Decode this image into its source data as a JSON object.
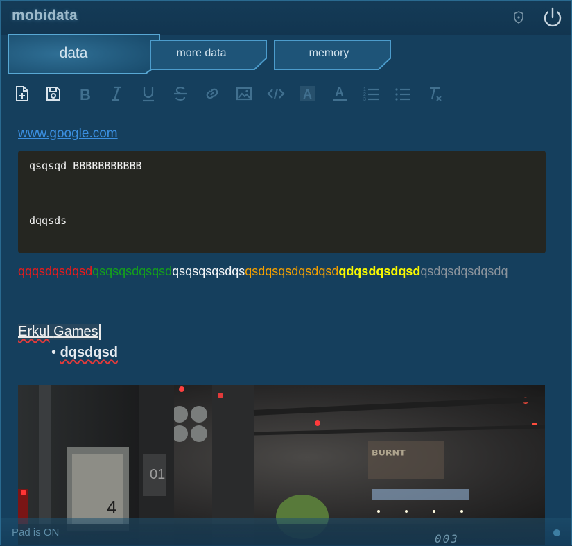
{
  "app": {
    "title": "mobidata"
  },
  "tabs": [
    {
      "label": "data",
      "active": true
    },
    {
      "label": "more data",
      "active": false
    },
    {
      "label": "memory",
      "active": false
    }
  ],
  "toolbar": {
    "buttons": [
      "new-document-icon",
      "save-icon",
      "bold-icon",
      "italic-icon",
      "underline-icon",
      "strikethrough-icon",
      "link-icon",
      "image-icon",
      "code-icon",
      "highlight-icon",
      "font-color-icon",
      "ordered-list-icon",
      "bullet-list-icon",
      "clear-format-icon"
    ]
  },
  "content": {
    "link": "www.google.com",
    "code": {
      "line1": "qsqsqd BBBBBBBBBBB",
      "line2": "dqqsds"
    },
    "colored_text": [
      {
        "text": "qqqsdqsdqsd",
        "color": "#ea1b1b"
      },
      {
        "text": "qsqsqsdqsqsd",
        "color": "#14a01b"
      },
      {
        "text": "qsqsqsqsdqs",
        "color": "#f2f4f6"
      },
      {
        "text": "qsdqsqsdqsdqsd",
        "color": "#f4a000"
      },
      {
        "text": "qdqsdqsdqsd",
        "color": "#f7f700"
      },
      {
        "text": "qsdqsdqsdqsdq",
        "color": "#8a939c"
      }
    ],
    "heading_word1": "Erkul",
    "heading_word2": "Games",
    "bullet_item": "dqsdqsd"
  },
  "status": {
    "text": "Pad is ON",
    "number": "003"
  },
  "colors": {
    "background": "#153f5d",
    "accent": "#4fb2e6",
    "code_bg": "#252621"
  }
}
